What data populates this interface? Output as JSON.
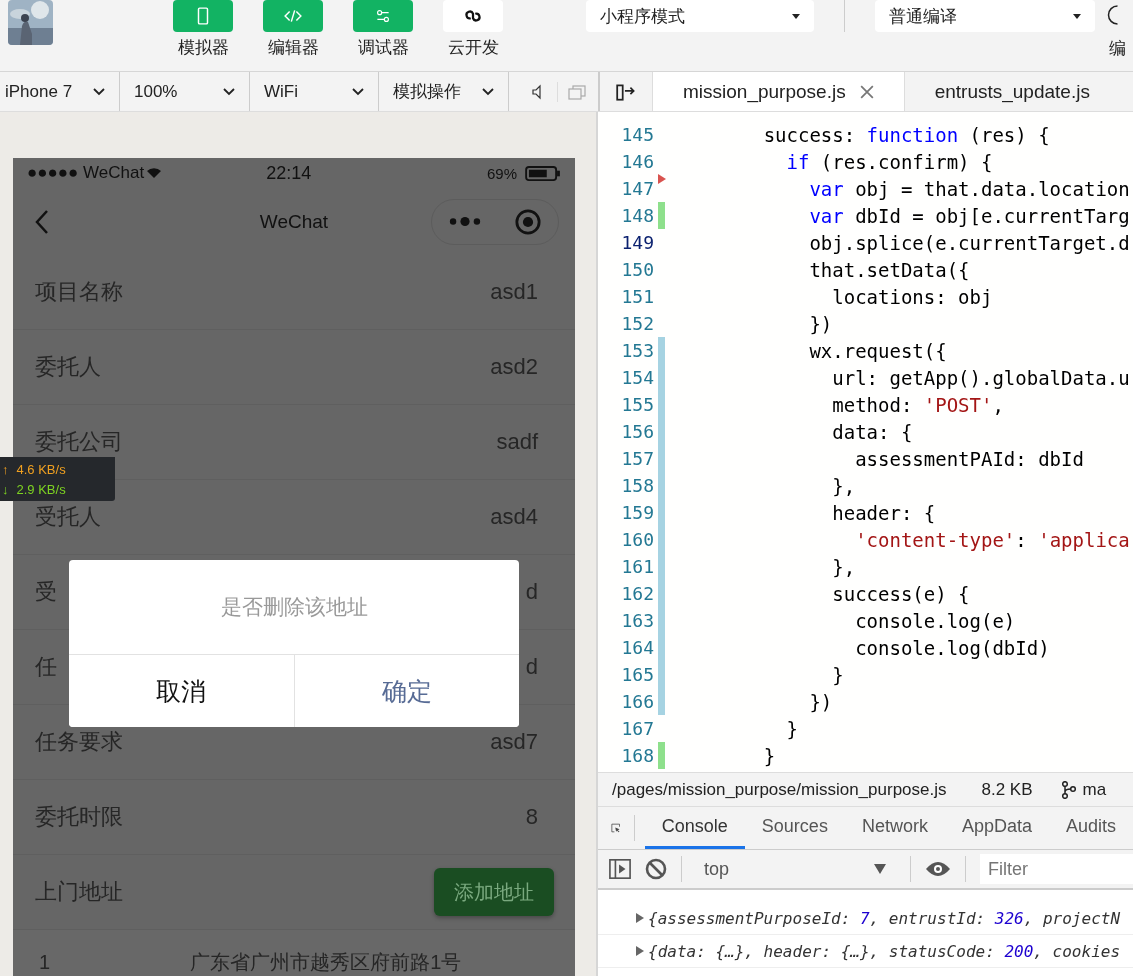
{
  "toolbar": {
    "buttons": [
      {
        "label": "模拟器",
        "kind": "simulator",
        "on": true
      },
      {
        "label": "编辑器",
        "kind": "editor",
        "on": true
      },
      {
        "label": "调试器",
        "kind": "debugger",
        "on": true
      },
      {
        "label": "云开发",
        "kind": "cloud",
        "on": false
      }
    ],
    "mode_select": "小程序模式",
    "compile_select": "普通编译",
    "cut_label": "编"
  },
  "sim_bar": {
    "selects": [
      "iPhone 7",
      "100%",
      "WiFi",
      "模拟操作"
    ]
  },
  "editor_tabs": [
    {
      "label": "mission_purpose.js",
      "selected": true
    },
    {
      "label": "entrusts_update.js",
      "selected": false
    }
  ],
  "phone": {
    "status": {
      "carrier": "●●●●● WeChat",
      "time": "22:14",
      "battery": "69%"
    },
    "nav_title": "WeChat",
    "rows": [
      {
        "kind": "text",
        "label": "项目名称",
        "value": "asd1"
      },
      {
        "kind": "text",
        "label": "委托人",
        "value": "asd2"
      },
      {
        "kind": "text",
        "label": "委托公司",
        "value": "sadf"
      },
      {
        "kind": "text",
        "label": "受托人",
        "value": "asd4"
      },
      {
        "kind": "text",
        "label": "受",
        "value": "d"
      },
      {
        "kind": "text",
        "label": "任",
        "value": "d"
      },
      {
        "kind": "text",
        "label": "任务要求",
        "value": "asd7"
      },
      {
        "kind": "text",
        "label": "委托时限",
        "value": "8"
      },
      {
        "kind": "button",
        "label": "上门地址",
        "value": "添加地址"
      }
    ],
    "addresses": [
      {
        "index": "1",
        "text": "广东省广州市越秀区府前路1号"
      }
    ]
  },
  "dialog": {
    "message": "是否删除该地址",
    "buttons": [
      {
        "kind": "cancel",
        "label": "取消"
      },
      {
        "kind": "confirm",
        "label": "确定"
      }
    ]
  },
  "net_speed": [
    {
      "arrow": "↑",
      "text": "4.6 KB/s",
      "color": "#f0a020"
    },
    {
      "arrow": "↓",
      "text": "2.9 KB/s",
      "color": "#7ed321"
    }
  ],
  "code": {
    "lines": [
      {
        "num": "145",
        "current": false,
        "tokens": [
          {
            "kind": "plain",
            "text": "      success: "
          },
          {
            "kind": "keyword",
            "text": "function"
          },
          {
            "kind": "plain",
            "text": " (res) {"
          }
        ]
      },
      {
        "num": "146",
        "current": false,
        "tokens": [
          {
            "kind": "keyword",
            "text": "        if"
          },
          {
            "kind": "plain",
            "text": " (res.confirm) {"
          }
        ]
      },
      {
        "num": "147",
        "kind": "deleted",
        "current": false,
        "tokens": [
          {
            "kind": "keyword",
            "text": "          var"
          },
          {
            "kind": "plain",
            "text": " obj = that.data.location"
          }
        ]
      },
      {
        "num": "148",
        "kind": "added",
        "current": false,
        "tokens": [
          {
            "kind": "keyword",
            "text": "          var"
          },
          {
            "kind": "plain",
            "text": " dbId = obj[e.currentTarg"
          }
        ]
      },
      {
        "num": "149",
        "current": true,
        "tokens": [
          {
            "kind": "plain",
            "text": "          obj.splice(e.currentTarget.d"
          }
        ]
      },
      {
        "num": "150",
        "current": false,
        "tokens": [
          {
            "kind": "plain",
            "text": "          that.setData({"
          }
        ]
      },
      {
        "num": "151",
        "current": false,
        "tokens": [
          {
            "kind": "plain",
            "text": "            locations: obj"
          }
        ]
      },
      {
        "num": "152",
        "current": false,
        "tokens": [
          {
            "kind": "plain",
            "text": "          })"
          }
        ]
      },
      {
        "num": "153",
        "kind": "modified",
        "current": false,
        "tokens": [
          {
            "kind": "plain",
            "text": "          wx.request({"
          }
        ]
      },
      {
        "num": "154",
        "kind": "modified",
        "current": false,
        "tokens": [
          {
            "kind": "plain",
            "text": "            url: getApp().globalData.u"
          }
        ]
      },
      {
        "num": "155",
        "kind": "modified",
        "current": false,
        "tokens": [
          {
            "kind": "plain",
            "text": "            method: "
          },
          {
            "kind": "string",
            "text": "'POST'"
          },
          {
            "kind": "plain",
            "text": ","
          }
        ]
      },
      {
        "num": "156",
        "kind": "modified",
        "current": false,
        "tokens": [
          {
            "kind": "plain",
            "text": "            data: {"
          }
        ]
      },
      {
        "num": "157",
        "kind": "modified",
        "current": false,
        "tokens": [
          {
            "kind": "plain",
            "text": "              assessmentPAId: dbId"
          }
        ]
      },
      {
        "num": "158",
        "kind": "modified",
        "current": false,
        "tokens": [
          {
            "kind": "plain",
            "text": "            },"
          }
        ]
      },
      {
        "num": "159",
        "kind": "modified",
        "current": false,
        "tokens": [
          {
            "kind": "plain",
            "text": "            header: {"
          }
        ]
      },
      {
        "num": "160",
        "kind": "modified",
        "current": false,
        "tokens": [
          {
            "kind": "string",
            "text": "              'content-type'"
          },
          {
            "kind": "plain",
            "text": ": "
          },
          {
            "kind": "string",
            "text": "'applica"
          }
        ]
      },
      {
        "num": "161",
        "kind": "modified",
        "current": false,
        "tokens": [
          {
            "kind": "plain",
            "text": "            },"
          }
        ]
      },
      {
        "num": "162",
        "kind": "modified",
        "current": false,
        "tokens": [
          {
            "kind": "plain",
            "text": "            success(e) {"
          }
        ]
      },
      {
        "num": "163",
        "kind": "modified",
        "current": false,
        "tokens": [
          {
            "kind": "plain",
            "text": "              console.log(e)"
          }
        ]
      },
      {
        "num": "164",
        "kind": "modified",
        "current": false,
        "tokens": [
          {
            "kind": "plain",
            "text": "              console.log(dbId)"
          }
        ]
      },
      {
        "num": "165",
        "kind": "modified",
        "current": false,
        "tokens": [
          {
            "kind": "plain",
            "text": "            }"
          }
        ]
      },
      {
        "num": "166",
        "kind": "modified",
        "current": false,
        "tokens": [
          {
            "kind": "plain",
            "text": "          })"
          }
        ]
      },
      {
        "num": "167",
        "current": false,
        "tokens": [
          {
            "kind": "plain",
            "text": "        }"
          }
        ]
      },
      {
        "num": "168",
        "kind": "added",
        "current": false,
        "tokens": [
          {
            "kind": "plain",
            "text": "      }"
          }
        ]
      }
    ]
  },
  "file_bar": {
    "path": "/pages/mission_purpose/mission_purpose.js",
    "size": "8.2 KB",
    "branch": "ma"
  },
  "devtools": {
    "tabs": [
      {
        "label": "Console",
        "selected": true
      },
      {
        "label": "Sources",
        "selected": false
      },
      {
        "label": "Network",
        "selected": false
      },
      {
        "label": "AppData",
        "selected": false
      },
      {
        "label": "Audits",
        "selected": false
      }
    ],
    "context": "top",
    "filter_placeholder": "Filter",
    "logs": [
      [
        {
          "kind": "plain",
          "text": "{assessmentPurposeId: "
        },
        {
          "kind": "number",
          "text": "7"
        },
        {
          "kind": "plain",
          "text": ", entrustId: "
        },
        {
          "kind": "number",
          "text": "326"
        },
        {
          "kind": "plain",
          "text": ", projectN"
        }
      ],
      [
        {
          "kind": "plain",
          "text": "{data: {…}, header: {…}, statusCode: "
        },
        {
          "kind": "number",
          "text": "200"
        },
        {
          "kind": "plain",
          "text": ", cookies"
        }
      ]
    ]
  }
}
